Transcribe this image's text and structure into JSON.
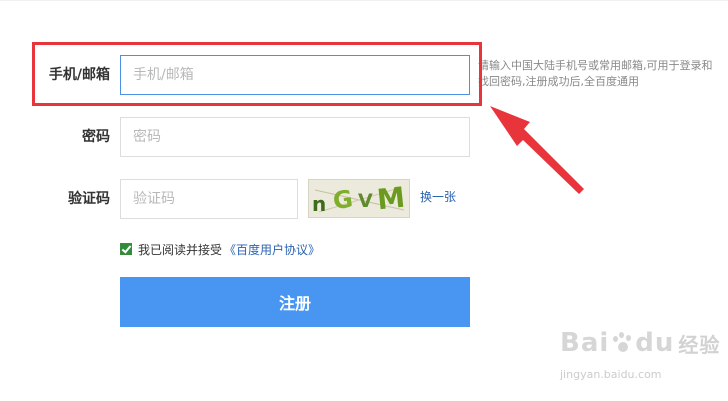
{
  "form": {
    "phone_label": "手机/邮箱",
    "phone_placeholder": "手机/邮箱",
    "phone_hint": "请输入中国大陆手机号或常用邮箱,可用于登录和找回密码,注册成功后,全百度通用",
    "password_label": "密码",
    "password_placeholder": "密码",
    "captcha_label": "验证码",
    "captcha_placeholder": "验证码",
    "captcha_chars": [
      "n",
      "G",
      "V",
      "M"
    ],
    "refresh_label": "换一张",
    "agree_text": "我已阅读并接受",
    "agree_link": "《百度用户协议》",
    "agree_checked": true,
    "register_label": "注册"
  },
  "watermark": {
    "logo_left": "Bai",
    "logo_right": "du",
    "logo_cn": "经验",
    "url": "jingyan.baidu.com"
  },
  "colors": {
    "highlight": "#e8353b",
    "button": "#4896f2",
    "link": "#2a62b0",
    "focus_border": "#4d90e4"
  }
}
